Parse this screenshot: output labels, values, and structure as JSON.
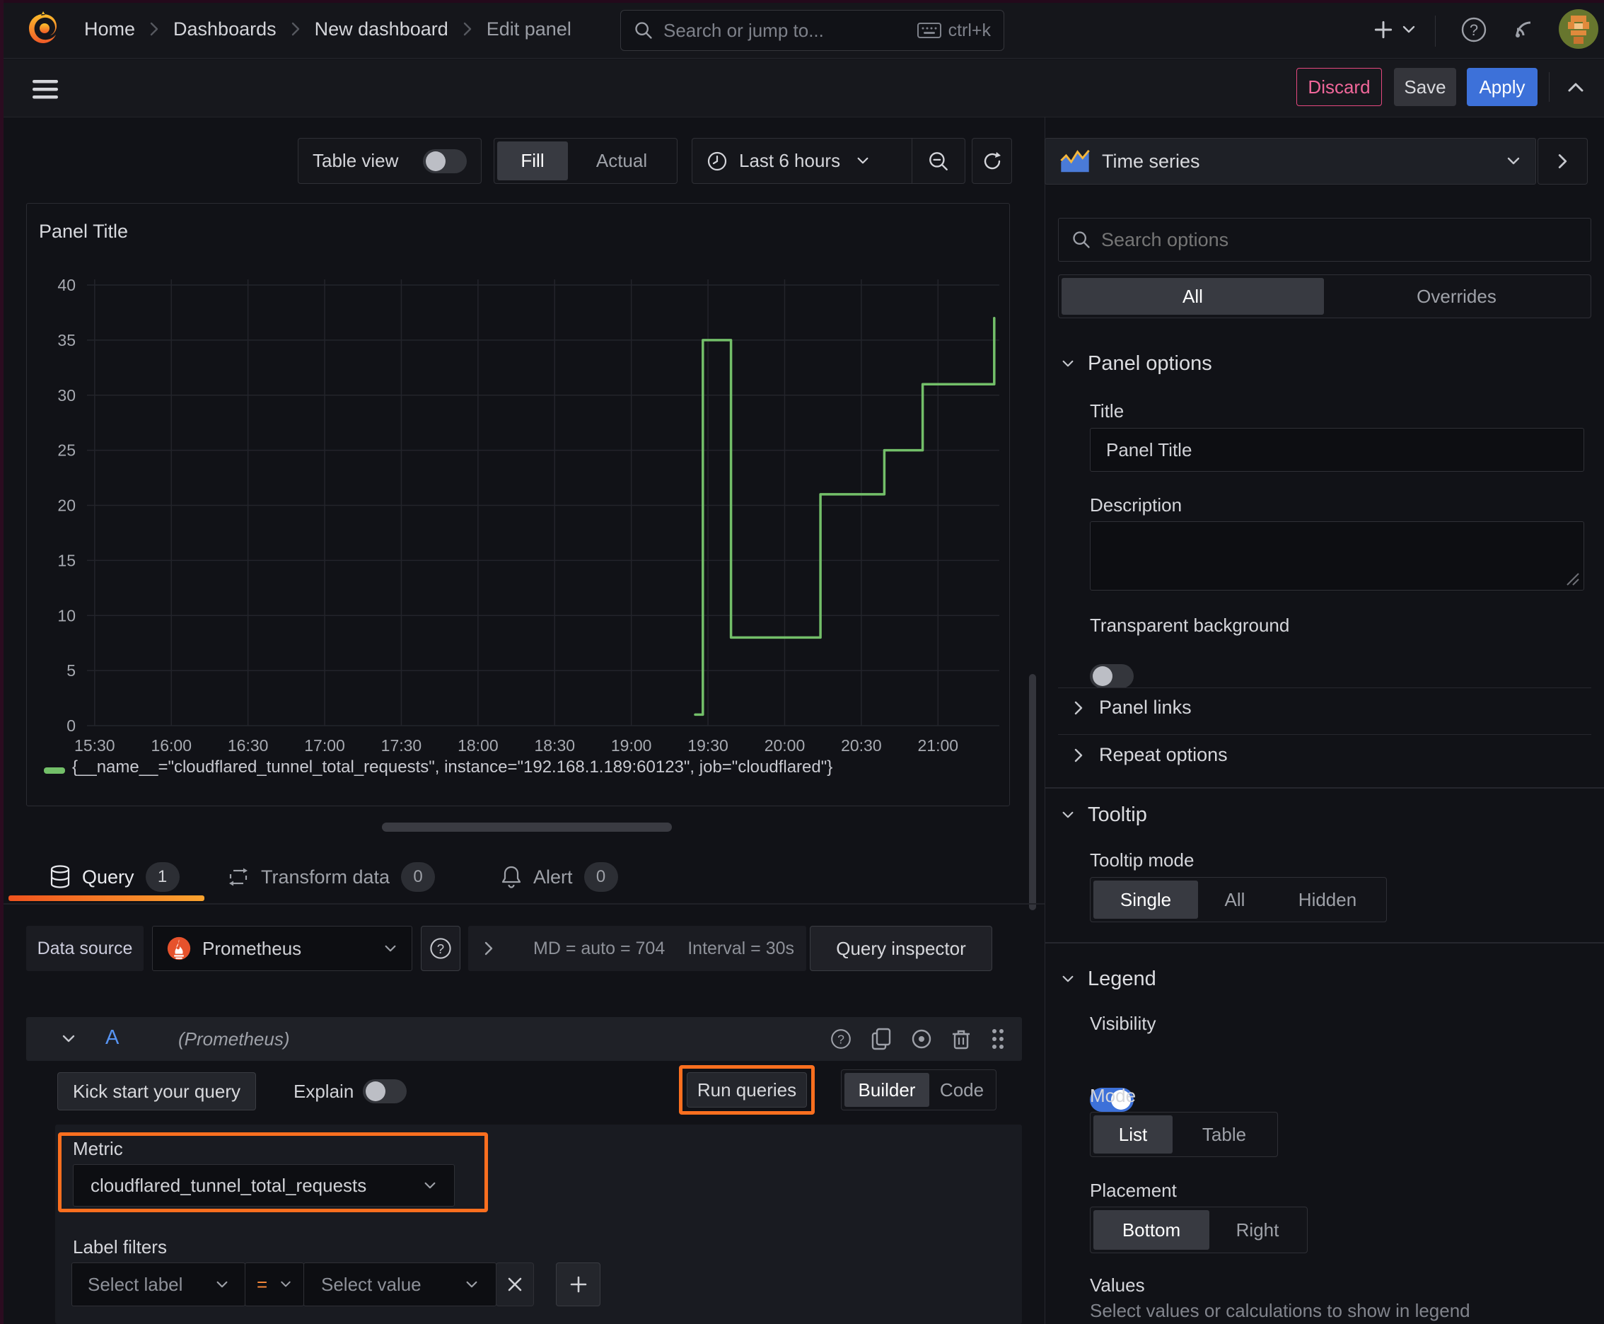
{
  "topbar": {
    "search_placeholder": "Search or jump to...",
    "shortcut": "ctrl+k"
  },
  "breadcrumb": {
    "items": [
      "Home",
      "Dashboards",
      "New dashboard",
      "Edit panel"
    ]
  },
  "actions": {
    "discard": "Discard",
    "save": "Save",
    "apply": "Apply"
  },
  "toolbar": {
    "table_view": "Table view",
    "fill": "Fill",
    "actual": "Actual",
    "time_range": "Last 6 hours"
  },
  "viz_picker": {
    "label": "Time series"
  },
  "options_search": {
    "placeholder": "Search options"
  },
  "options_tabs": {
    "all": "All",
    "overrides": "Overrides"
  },
  "panel_options": {
    "header": "Panel options",
    "title_label": "Title",
    "title_value": "Panel Title",
    "description_label": "Description",
    "transparent_label": "Transparent background",
    "panel_links": "Panel links",
    "repeat_options": "Repeat options"
  },
  "tooltip": {
    "header": "Tooltip",
    "mode_label": "Tooltip mode",
    "single": "Single",
    "all": "All",
    "hidden": "Hidden"
  },
  "legend": {
    "header": "Legend",
    "visibility_label": "Visibility",
    "mode_label": "Mode",
    "list": "List",
    "table": "Table",
    "placement_label": "Placement",
    "bottom": "Bottom",
    "right": "Right",
    "values_label": "Values",
    "values_hint": "Select values or calculations to show in legend"
  },
  "query_tabs": {
    "query": "Query",
    "query_count": "1",
    "transform": "Transform data",
    "transform_count": "0",
    "alert": "Alert",
    "alert_count": "0"
  },
  "datasource": {
    "label": "Data source",
    "name": "Prometheus",
    "md_stat": "MD = auto = 704",
    "interval_stat": "Interval = 30s",
    "inspector": "Query inspector"
  },
  "query_row": {
    "ref": "A",
    "ds_hint": "(Prometheus)"
  },
  "query_actions": {
    "kickstart": "Kick start your query",
    "explain": "Explain",
    "run": "Run queries",
    "builder": "Builder",
    "code": "Code"
  },
  "metric": {
    "label": "Metric",
    "value": "cloudflared_tunnel_total_requests"
  },
  "label_filters": {
    "label": "Label filters",
    "select_label": "Select label",
    "operator": "=",
    "select_value": "Select value"
  },
  "chart_data": {
    "type": "line",
    "title": "Panel Title",
    "line_interpolation": "step-after",
    "line_color": "#73bf69",
    "grid": true,
    "legend_position": "bottom",
    "x_range": [
      "15:27",
      "21:24"
    ],
    "x_ticks": [
      "15:30",
      "16:00",
      "16:30",
      "17:00",
      "17:30",
      "18:00",
      "18:30",
      "19:00",
      "19:30",
      "20:00",
      "20:30",
      "21:00"
    ],
    "ylim": [
      0,
      40
    ],
    "y_ticks": [
      0,
      5,
      10,
      15,
      20,
      25,
      30,
      35,
      40
    ],
    "series": [
      {
        "name": "{__name__=\"cloudflared_tunnel_total_requests\", instance=\"192.168.1.189:60123\", job=\"cloudflared\"}",
        "points": [
          {
            "t": "19:25",
            "v": 1
          },
          {
            "t": "19:28",
            "v": 35
          },
          {
            "t": "19:39",
            "v": 8
          },
          {
            "t": "20:14",
            "v": 21
          },
          {
            "t": "20:39",
            "v": 25
          },
          {
            "t": "20:54",
            "v": 31
          },
          {
            "t": "21:22",
            "v": 37
          }
        ]
      }
    ]
  }
}
